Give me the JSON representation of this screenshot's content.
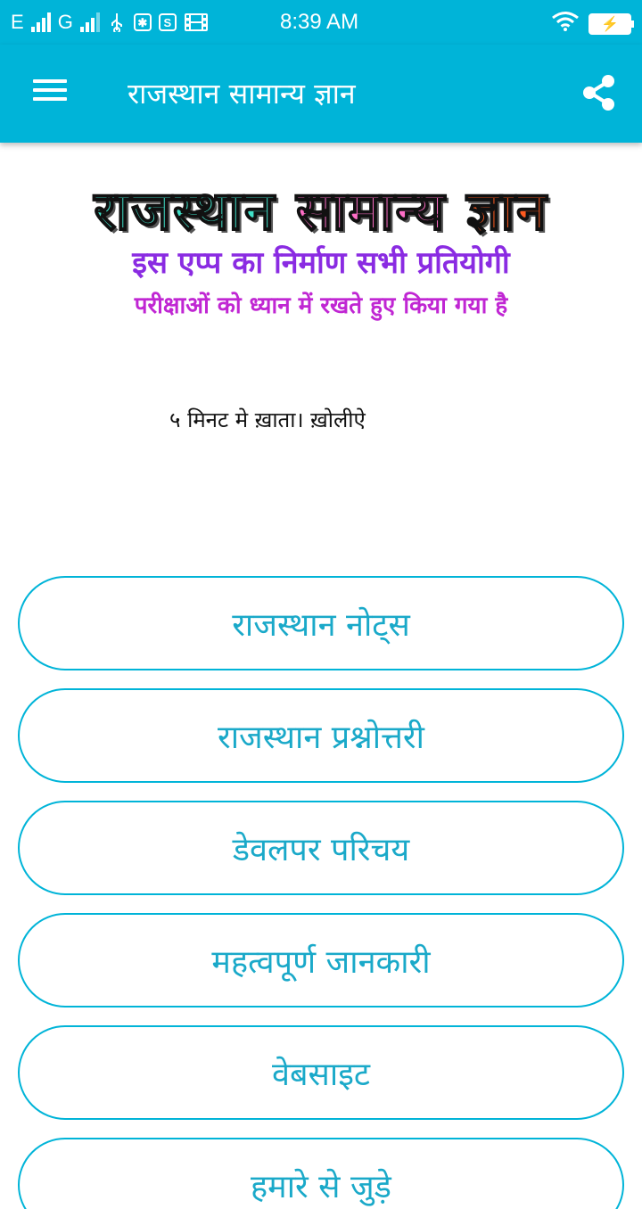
{
  "status_bar": {
    "network_1": "E",
    "network_2": "G",
    "time": "8:39 AM",
    "icons": [
      "signal-icon",
      "usb-icon",
      "usb-debug-icon",
      "s-icon",
      "film-icon",
      "wifi-icon",
      "battery-charging-icon"
    ]
  },
  "app_bar": {
    "title": "राजस्थान सामान्य ज्ञान",
    "menu_icon": "hamburger-menu-icon",
    "share_icon": "share-icon"
  },
  "banner": {
    "title_word1": "राजस्थान",
    "title_word2": "सामान्य",
    "title_word3": "ज्ञान",
    "line1": "इस एप्प का निर्माण सभी प्रतियोगी",
    "line2": "परीक्षाओं को ध्यान में रखते हुए किया गया है"
  },
  "tagline": "५ मिनट मे ख़ाता। ख़ोलीऐ",
  "menu_items": [
    {
      "label": "राजस्थान नोट्स"
    },
    {
      "label": "राजस्थान प्रश्नोत्तरी"
    },
    {
      "label": "डेवलपर परिचय"
    },
    {
      "label": "महत्वपूर्ण जानकारी"
    },
    {
      "label": "वेबसाइट"
    },
    {
      "label": "हमारे से जुड़े"
    }
  ],
  "colors": {
    "primary": "#00b4d8",
    "button_text": "#1aa9c9",
    "banner_cyan": "#40e0c8",
    "banner_pink": "#ff6ec7",
    "banner_orange": "#ff5a1f",
    "banner_purple": "#8a2be2",
    "banner_magenta": "#c026d3"
  }
}
